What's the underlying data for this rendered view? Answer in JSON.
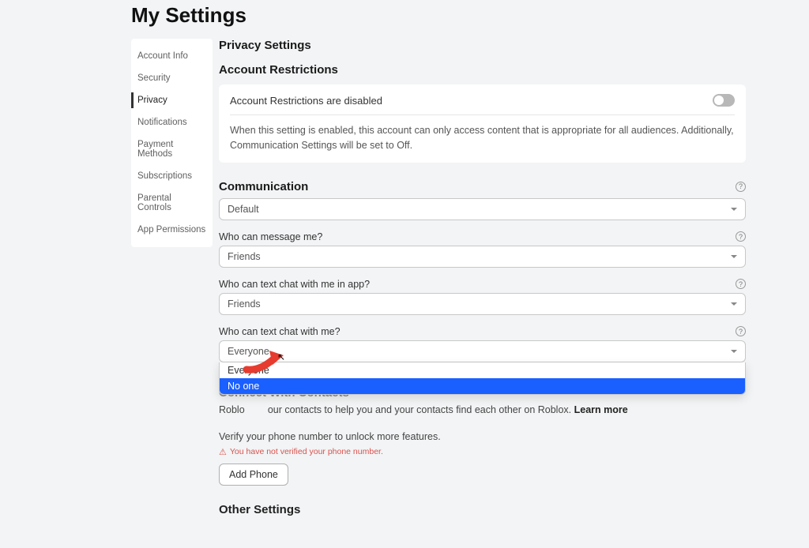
{
  "page_title": "My Settings",
  "sidebar": {
    "items": [
      {
        "label": "Account Info"
      },
      {
        "label": "Security"
      },
      {
        "label": "Privacy",
        "active": true
      },
      {
        "label": "Notifications"
      },
      {
        "label": "Payment Methods"
      },
      {
        "label": "Subscriptions"
      },
      {
        "label": "Parental Controls"
      },
      {
        "label": "App Permissions"
      }
    ]
  },
  "privacy": {
    "title": "Privacy Settings",
    "restrictions": {
      "title": "Account Restrictions",
      "toggle_label": "Account Restrictions are disabled",
      "help": "When this setting is enabled, this account can only access content that is appropriate for all audiences. Additionally, Communication Settings will be set to Off."
    },
    "communication": {
      "title": "Communication",
      "default_select": "Default",
      "fields": [
        {
          "label": "Who can message me?",
          "value": "Friends"
        },
        {
          "label": "Who can text chat with me in app?",
          "value": "Friends"
        },
        {
          "label": "Who can text chat with me?",
          "value": "Everyone"
        }
      ],
      "dropdown_options": [
        "Everyone",
        "No one"
      ],
      "dropdown_selected": "No one"
    },
    "connect": {
      "title": "Connect With Contacts",
      "text_prefix": "Roblo",
      "text_suffix": "our contacts to help you and your contacts find each other on Roblox.",
      "learn_more": "Learn more"
    },
    "verify": {
      "text": "Verify your phone number to unlock more features.",
      "warning": "You have not verified your phone number.",
      "button": "Add Phone"
    },
    "other": "Other Settings"
  }
}
